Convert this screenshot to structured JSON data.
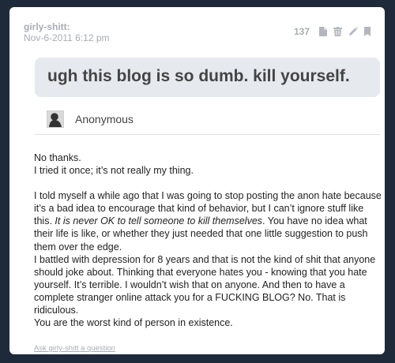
{
  "post": {
    "author": "girly-shitt:",
    "date": "Nov-6-2011 6:12 pm",
    "notes_count": "137"
  },
  "controls": {
    "icons": [
      "notes-document-icon",
      "trash-icon",
      "pencil-icon",
      "bookmark-icon"
    ]
  },
  "question": {
    "text": "ugh this blog is so dumb. kill yourself.",
    "asker": "Anonymous"
  },
  "answer": {
    "line1": "No thanks.",
    "line2": "I tried it once; it’s not really my thing.",
    "para_before_italic": "I told myself a while ago that I was going to stop posting the anon hate because it’s a bad idea to encourage that kind of behavior, but I can’t ignore stuff like this. ",
    "italic": "It is never OK to tell someone to kill themselves",
    "para_after_italic": ". You have no idea what their life is like, or whether they just needed that one little suggestion to push them over the edge.",
    "para2": "I battled with depression for 8 years and that is not the kind of shit that anyone should joke about. Thinking that everyone hates you - knowing that you hate yourself. It’s terrible. I wouldn’t wish that on anyone. And then to have a complete stranger online attack you for a FUCKING BLOG? No. That is ridiculous.",
    "para3": "You are the worst kind of person in existence."
  },
  "footer": {
    "ask_link": "Ask girly-shitt a question"
  },
  "colors": {
    "background": "#1e2a3a",
    "card": "#ffffff",
    "question_bg": "#e6eaee",
    "meta_text": "#a8adb4"
  }
}
